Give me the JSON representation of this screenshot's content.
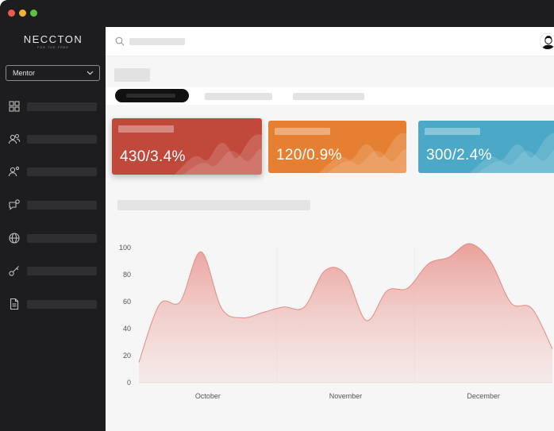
{
  "window": {
    "controls": [
      "close",
      "minimize",
      "maximize"
    ]
  },
  "brand": {
    "logo": "NECCTON",
    "tagline": "FOR THE FREE"
  },
  "sidebar": {
    "role_select": {
      "value": "Mentor"
    },
    "items": [
      {
        "icon": "grid-icon"
      },
      {
        "icon": "users-icon"
      },
      {
        "icon": "user-settings-icon"
      },
      {
        "icon": "chat-settings-icon"
      },
      {
        "icon": "globe-icon"
      },
      {
        "icon": "key-icon"
      },
      {
        "icon": "document-icon"
      }
    ]
  },
  "topbar": {
    "search_icon": "search-icon",
    "avatar": "avatar"
  },
  "cards": [
    {
      "value": "430/3.4%",
      "color": "#c1493c"
    },
    {
      "value": "120/0.9%",
      "color": "#e58033"
    },
    {
      "value": "300/2.4%",
      "color": "#4ba8c7"
    }
  ],
  "chart_data": {
    "type": "area",
    "color": "#e9a19b",
    "x_categories": [
      "October",
      "November",
      "December"
    ],
    "y_ticks": [
      "0",
      "20",
      "40",
      "60",
      "80",
      "100"
    ],
    "ylim": [
      0,
      100
    ],
    "grid": true,
    "series": [
      {
        "values": [
          15,
          58,
          60,
          97,
          55,
          48,
          52,
          56,
          56,
          83,
          80,
          46,
          68,
          70,
          88,
          93,
          103,
          90,
          59,
          55,
          25
        ]
      }
    ]
  }
}
